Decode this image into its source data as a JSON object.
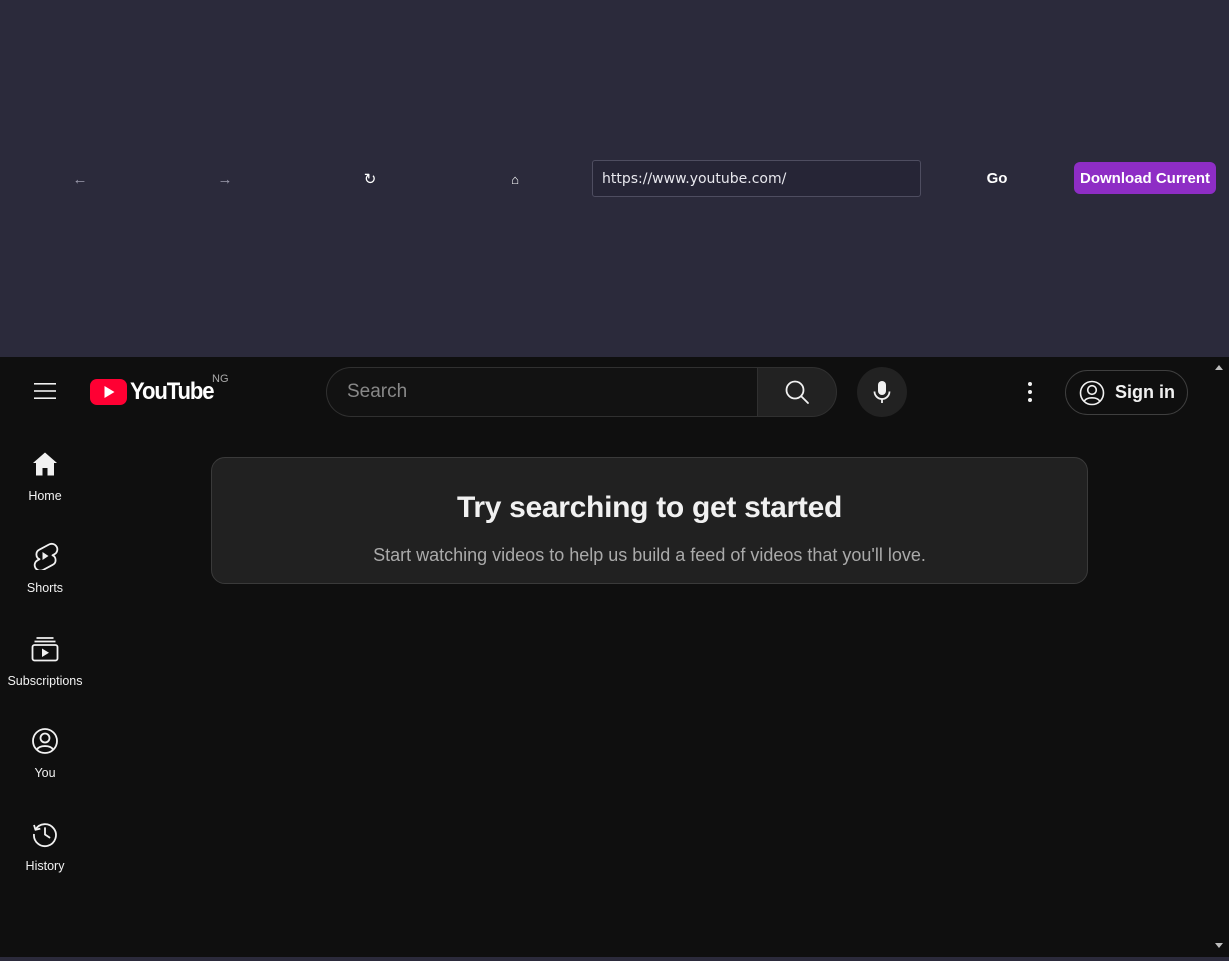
{
  "toolbar": {
    "back_label": "←",
    "forward_label": "→",
    "reload_label": "↻",
    "home_label": "⌂",
    "url_value": "https://www.youtube.com/",
    "go_label": "Go",
    "download_label": "Download Current"
  },
  "youtube": {
    "logo_text": "YouTube",
    "country_code": "NG",
    "search_placeholder": "Search",
    "signin_label": "Sign in",
    "sidebar": {
      "items": [
        {
          "label": "Home",
          "icon": "home-icon"
        },
        {
          "label": "Shorts",
          "icon": "shorts-icon"
        },
        {
          "label": "Subscriptions",
          "icon": "subscriptions-icon"
        },
        {
          "label": "You",
          "icon": "you-icon"
        },
        {
          "label": "History",
          "icon": "history-icon"
        }
      ]
    },
    "empty_state": {
      "title": "Try searching to get started",
      "subtitle": "Start watching videos to help us build a feed of videos that you'll love."
    }
  },
  "colors": {
    "toolbar_bg": "#2b2a3b",
    "download_accent": "#8e2dc5",
    "youtube_bg": "#0f0f0f",
    "youtube_red": "#ff0033",
    "card_bg": "#212121"
  }
}
